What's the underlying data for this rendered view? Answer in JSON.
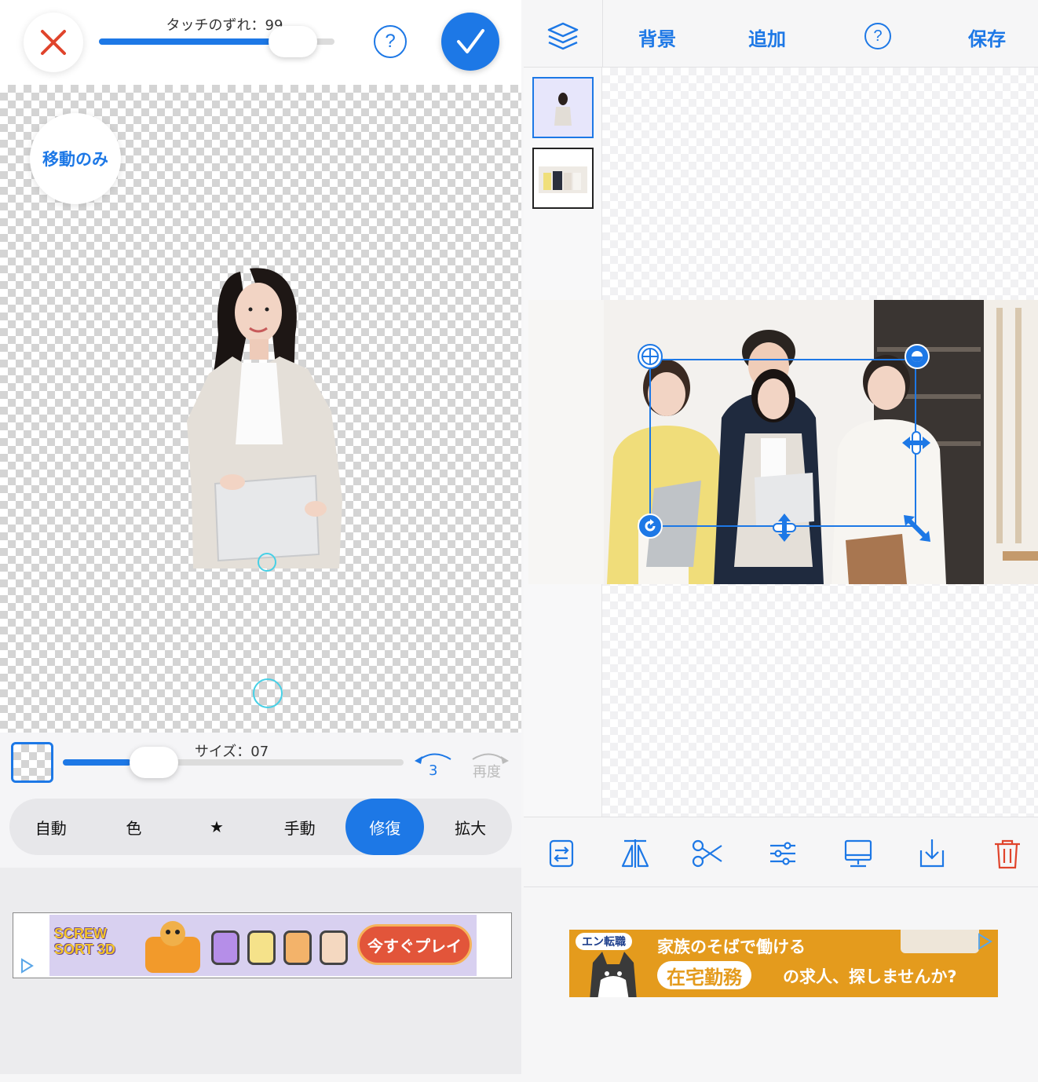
{
  "left_panel": {
    "touch_offset_label": "タッチのずれ：99",
    "touch_offset_value": 99,
    "touch_offset_fraction": 0.84,
    "help_symbol": "?",
    "move_only_label": "移動のみ",
    "size_label": "サイズ：07",
    "size_value": 7,
    "size_fraction": 0.2,
    "undo_count": "3",
    "redo_label": "再度",
    "modes": [
      {
        "label": "自動",
        "active": false
      },
      {
        "label": "色",
        "active": false
      },
      {
        "label": "★",
        "active": false
      },
      {
        "label": "手動",
        "active": false
      },
      {
        "label": "修復",
        "active": true
      },
      {
        "label": "拡大",
        "active": false
      }
    ],
    "ad": {
      "game_title": "SCREW SORT 3D",
      "cta": "今すぐプレイ"
    }
  },
  "right_panel": {
    "menu": {
      "background": "背景",
      "add": "追加",
      "help": "?",
      "save": "保存"
    },
    "tools": [
      "flip-icon",
      "mirror-icon",
      "cut-icon",
      "adjust-icon",
      "display-icon",
      "download-icon",
      "trash-icon"
    ],
    "ad": {
      "brand": "エン転職",
      "line1": "家族のそばで働ける",
      "highlight": "在宅勤務",
      "line2": "の求人、探しませんか?"
    }
  },
  "colors": {
    "accent": "#1d78e6",
    "danger": "#e0442c",
    "ring": "#47d0e6"
  }
}
